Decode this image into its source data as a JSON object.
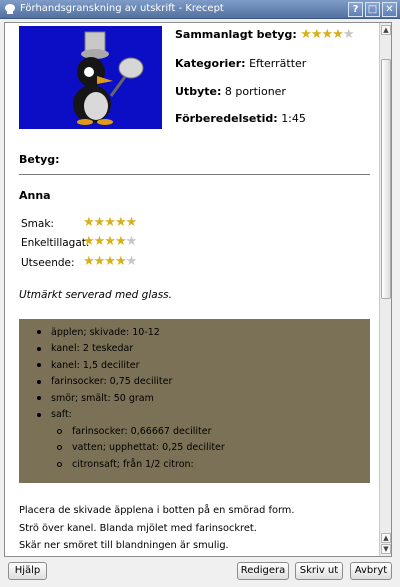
{
  "window": {
    "title": "Förhandsgranskning av utskrift - Krecept",
    "controls": [
      "?",
      "□",
      "✕"
    ]
  },
  "recipe": {
    "overall_rating_label": "Sammanlagt betyg:",
    "overall_rating": 4,
    "category_label": "Kategorier:",
    "category": "Efterrätter",
    "yield_label": "Utbyte:",
    "yield": "8 portioner",
    "prep_label": "Förberedelsetid:",
    "prep": "1:45"
  },
  "ratings_heading": "Betyg:",
  "reviewer": {
    "name": "Anna",
    "criteria": [
      {
        "label": "Smak:",
        "stars": 5
      },
      {
        "label": "Enkeltillagat:",
        "stars": 4
      },
      {
        "label": "Utseende:",
        "stars": 4
      }
    ],
    "comment": "Utmärkt serverad med glass."
  },
  "ingredients": [
    {
      "text": "äpplen; skivade: 10-12",
      "level": 0
    },
    {
      "text": "kanel: 2 teskedar",
      "level": 0
    },
    {
      "text": "kanel: 1,5 deciliter",
      "level": 0
    },
    {
      "text": "farinsocker: 0,75 deciliter",
      "level": 0
    },
    {
      "text": "smör; smält: 50 gram",
      "level": 0
    },
    {
      "text": "saft:",
      "level": 0
    },
    {
      "text": "farinsocker: 0,66667 deciliter",
      "level": 1
    },
    {
      "text": "vatten; upphettat: 0,25 deciliter",
      "level": 1
    },
    {
      "text": "citronsaft; från 1/2 citron:",
      "level": 1
    }
  ],
  "directions": [
    "Placera de skivade äpplena i botten på en smörad form.",
    "Strö över kanel. Blanda mjölet med farinsockret.",
    "Skär ner smöret till blandningen är smulig."
  ],
  "buttons": {
    "help": "Hjälp",
    "edit": "Redigera",
    "print": "Skriv ut",
    "cancel": "Avbryt"
  },
  "colors": {
    "titlebar": "#6584b8",
    "ingredients_bg": "#7b7156",
    "picture_bg": "#0b0ec4",
    "star": "#d8b01a"
  }
}
